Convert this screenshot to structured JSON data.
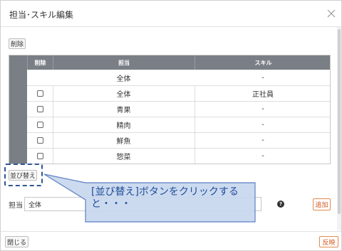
{
  "dialog": {
    "title": "担当･スキル編集",
    "close_icon": "close-icon"
  },
  "toolbar": {
    "delete_label": "削除",
    "sort_label": "並び替え"
  },
  "grid": {
    "columns": [
      "削除",
      "担当",
      "スキル"
    ],
    "rows": [
      {
        "checkbox": false,
        "tanto": "全体",
        "skill": "-"
      },
      {
        "checkbox": true,
        "tanto": "全体",
        "skill": "正社員"
      },
      {
        "checkbox": true,
        "tanto": "青果",
        "skill": "-"
      },
      {
        "checkbox": true,
        "tanto": "精肉",
        "skill": "-"
      },
      {
        "checkbox": true,
        "tanto": "鮮魚",
        "skill": "-"
      },
      {
        "checkbox": true,
        "tanto": "惣菜",
        "skill": "-"
      }
    ]
  },
  "form": {
    "tanto_label": "担当",
    "tanto_value": "全体",
    "help_icon": "?",
    "add_label": "追加"
  },
  "footer": {
    "close_label": "閉じる",
    "apply_label": "反映"
  },
  "callout": {
    "line1": "[並び替え]ボタンをクリックする",
    "line2": "と・・・"
  },
  "colors": {
    "header_bg": "#7a7f86",
    "accent_orange": "#d2581e",
    "callout_fill": "#c8d7ee",
    "callout_border": "#5b7fc4",
    "callout_text": "#1f4e99"
  }
}
